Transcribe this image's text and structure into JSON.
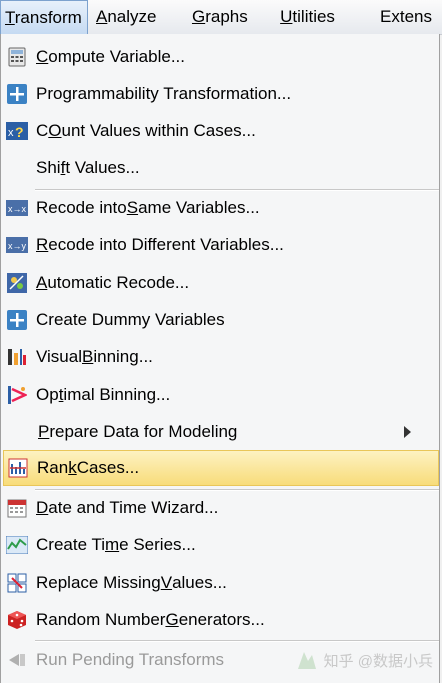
{
  "menubar": {
    "items": [
      {
        "label": "Transform",
        "u": "T",
        "rest": "ransform"
      },
      {
        "label": "Analyze",
        "u": "A",
        "rest": "nalyze"
      },
      {
        "label": "Graphs",
        "u": "G",
        "rest": "raphs"
      },
      {
        "label": "Utilities",
        "u": "U",
        "rest": "tilities"
      },
      {
        "label": "Extens",
        "u": "",
        "rest": "Extens"
      }
    ]
  },
  "menu": {
    "items": [
      {
        "pre": "",
        "u": "C",
        "post": "ompute Variable...",
        "icon": "calculator-icon"
      },
      {
        "pre": "",
        "u": "",
        "post": "Programmability Transformation...",
        "icon": "plus-icon"
      },
      {
        "pre": "",
        "u": "O",
        "post": "unt Values within Cases...",
        "pre_text": "C",
        "icon": "count-values-icon"
      },
      {
        "pre": "Shi",
        "u": "f",
        "post": "t Values...",
        "icon": ""
      },
      {
        "pre": "Recode into ",
        "u": "S",
        "post": "ame Variables...",
        "icon": "recode-same-icon"
      },
      {
        "pre": "",
        "u": "R",
        "post": "ecode into Different Variables...",
        "icon": "recode-different-icon"
      },
      {
        "pre": "",
        "u": "A",
        "post": "utomatic Recode...",
        "icon": "automatic-recode-icon"
      },
      {
        "pre": "",
        "u": "",
        "post": "Create Dummy Variables",
        "icon": "plus-icon"
      },
      {
        "pre": "Visual ",
        "u": "B",
        "post": "inning...",
        "icon": "visual-binning-icon"
      },
      {
        "pre": "Op",
        "u": "t",
        "post": "imal Binning...",
        "icon": "optimal-binning-icon"
      },
      {
        "pre": "",
        "u": "P",
        "post": "repare Data for Modeling",
        "icon": ""
      },
      {
        "pre": "Ran",
        "u": "k",
        "post": " Cases...",
        "icon": "rank-cases-icon"
      },
      {
        "pre": "",
        "u": "D",
        "post": "ate and Time Wizard...",
        "icon": "calendar-icon"
      },
      {
        "pre": "Create Ti",
        "u": "m",
        "post": "e Series...",
        "icon": "time-series-icon"
      },
      {
        "pre": "Replace Missing ",
        "u": "V",
        "post": "alues...",
        "icon": "replace-missing-icon"
      },
      {
        "pre": "Random Number ",
        "u": "G",
        "post": "enerators...",
        "icon": "dice-icon"
      },
      {
        "pre": "",
        "u": "",
        "post": "Run Pending Transforms",
        "icon": "run-pending-icon"
      }
    ]
  },
  "watermark": {
    "text": "知乎 @数据小兵"
  }
}
